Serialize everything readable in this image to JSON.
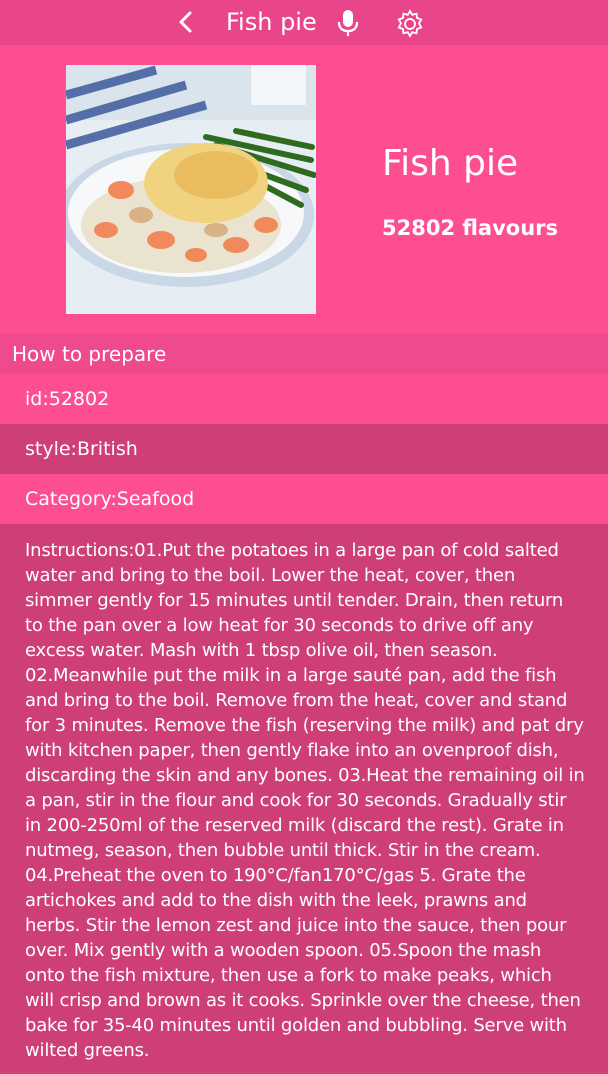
{
  "topbar": {
    "title": "Fish pie",
    "back_icon": "chevron-left-icon",
    "mic_icon": "microphone-icon",
    "settings_icon": "gear-icon"
  },
  "recipe": {
    "image_alt": "Fish pie photo",
    "title": "Fish pie",
    "flavours": "52802 flavours"
  },
  "section": {
    "heading": "How to prepare"
  },
  "details": {
    "id": "id:52802",
    "style": "style:British",
    "category": "Category:Seafood",
    "instructions": "Instructions:01.Put the potatoes in a large pan of cold salted water and bring to the boil. Lower the heat, cover, then simmer gently for 15 minutes until tender. Drain, then return to the pan over a low heat for 30 seconds to drive off any excess water. Mash with 1 tbsp olive oil, then season. 02.Meanwhile put the milk in a large sauté pan, add the fish and bring to the boil. Remove from the heat, cover and stand for 3 minutes. Remove the fish (reserving the milk) and pat dry with kitchen paper, then gently flake into an ovenproof dish, discarding the skin and any bones. 03.Heat the remaining oil in a pan, stir in the flour and cook for 30 seconds. Gradually stir in 200-250ml of the reserved milk (discard the rest). Grate in nutmeg, season, then bubble until thick. Stir in the cream. 04.Preheat the oven to 190°C/fan170°C/gas 5. Grate the artichokes and add to the dish with the leek, prawns and herbs. Stir the lemon zest and juice into the sauce, then pour over. Mix gently with a wooden spoon. 05.Spoon the mash onto the fish mixture, then use a fork to make peaks, which will crisp and brown as it cooks. Sprinkle over the cheese, then bake for 35-40 minutes until golden and bubbling. Serve with wilted greens."
  },
  "colors": {
    "primary": "#fc4e91",
    "topbar": "#e8458a",
    "alt_row": "#cf3f77",
    "text": "#ffffff"
  }
}
